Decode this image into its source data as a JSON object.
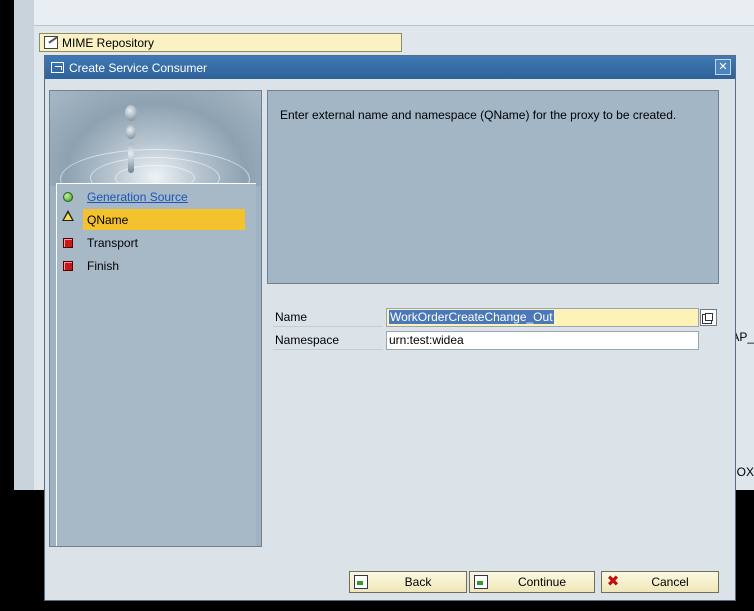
{
  "background": {
    "mime_label": "MIME Repository",
    "right_frag_1": "AP_",
    "right_frag_2": "OX"
  },
  "dialog": {
    "title": "Create Service Consumer",
    "close_label": "✕"
  },
  "wizard": {
    "steps": [
      {
        "label": "Generation Source",
        "status": "done",
        "icon": "green-dot-icon"
      },
      {
        "label": "QName",
        "status": "current",
        "icon": "warning-triangle-icon"
      },
      {
        "label": "Transport",
        "status": "pending",
        "icon": "red-square-icon"
      },
      {
        "label": "Finish",
        "status": "pending",
        "icon": "red-square-icon"
      }
    ]
  },
  "description": "Enter external name and namespace (QName) for the proxy to be created.",
  "form": {
    "name_label": "Name",
    "name_value": "WorkOrderCreateChange_Out",
    "namespace_label": "Namespace",
    "namespace_value": "urn:test:widea"
  },
  "buttons": {
    "back": "Back",
    "continue": "Continue",
    "cancel": "Cancel"
  },
  "colors": {
    "title_bar": "#3f79b3",
    "current_step_highlight": "#f4c22c",
    "focused_input": "#fdf3b8",
    "link": "#1a55b8"
  }
}
